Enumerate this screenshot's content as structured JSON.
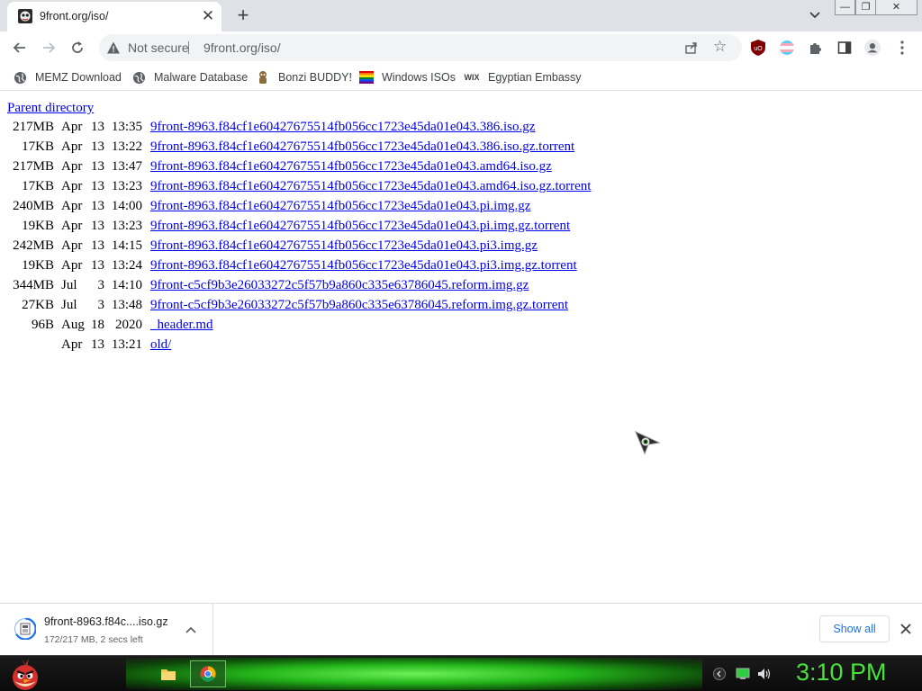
{
  "tab": {
    "title": "9front.org/iso/",
    "close_glyph": "✕",
    "newtab_glyph": "+"
  },
  "window_controls": {
    "minimize": "—",
    "restore": "❐",
    "close": "✕"
  },
  "omnibox": {
    "security_text": "Not secure",
    "url": "9front.org/iso/"
  },
  "bookmarks": [
    {
      "label": "MEMZ Download",
      "icon": "globe-icon"
    },
    {
      "label": "Malware Database",
      "icon": "globe-icon"
    },
    {
      "label": "Bonzi BUDDY!",
      "icon": "bonzi-icon"
    },
    {
      "label": "Windows ISOs",
      "icon": "rainbow-flag-icon"
    },
    {
      "label": "Egyptian Embassy",
      "icon": "wix-icon"
    }
  ],
  "page": {
    "parent_link": "Parent directory",
    "files": [
      {
        "size": "217MB",
        "month": "Apr",
        "day": "13",
        "time": "13:35",
        "name": "9front-8963.f84cf1e60427675514fb056cc1723e45da01e043.386.iso.gz"
      },
      {
        "size": "17KB",
        "month": "Apr",
        "day": "13",
        "time": "13:22",
        "name": "9front-8963.f84cf1e60427675514fb056cc1723e45da01e043.386.iso.gz.torrent"
      },
      {
        "size": "217MB",
        "month": "Apr",
        "day": "13",
        "time": "13:47",
        "name": "9front-8963.f84cf1e60427675514fb056cc1723e45da01e043.amd64.iso.gz"
      },
      {
        "size": "17KB",
        "month": "Apr",
        "day": "13",
        "time": "13:23",
        "name": "9front-8963.f84cf1e60427675514fb056cc1723e45da01e043.amd64.iso.gz.torrent"
      },
      {
        "size": "240MB",
        "month": "Apr",
        "day": "13",
        "time": "14:00",
        "name": "9front-8963.f84cf1e60427675514fb056cc1723e45da01e043.pi.img.gz"
      },
      {
        "size": "19KB",
        "month": "Apr",
        "day": "13",
        "time": "13:23",
        "name": "9front-8963.f84cf1e60427675514fb056cc1723e45da01e043.pi.img.gz.torrent"
      },
      {
        "size": "242MB",
        "month": "Apr",
        "day": "13",
        "time": "14:15",
        "name": "9front-8963.f84cf1e60427675514fb056cc1723e45da01e043.pi3.img.gz"
      },
      {
        "size": "19KB",
        "month": "Apr",
        "day": "13",
        "time": "13:24",
        "name": "9front-8963.f84cf1e60427675514fb056cc1723e45da01e043.pi3.img.gz.torrent"
      },
      {
        "size": "344MB",
        "month": "Jul",
        "day": "3",
        "time": "14:10",
        "name": "9front-c5cf9b3e26033272c5f57b9a860c335e63786045.reform.img.gz"
      },
      {
        "size": "27KB",
        "month": "Jul",
        "day": "3",
        "time": "13:48",
        "name": "9front-c5cf9b3e26033272c5f57b9a860c335e63786045.reform.img.gz.torrent"
      },
      {
        "size": "96B",
        "month": "Aug",
        "day": "18",
        "time": "2020",
        "name": "_header.md"
      },
      {
        "size": "",
        "month": "Apr",
        "day": "13",
        "time": "13:21",
        "name": "old/"
      }
    ]
  },
  "download": {
    "name": "9front-8963.f84c....iso.gz",
    "status": "172/217 MB, 2 secs left",
    "show_all": "Show all"
  },
  "taskbar": {
    "clock": "3:10 PM"
  },
  "colors": {
    "link": "#0000ee",
    "clock": "#49e23d",
    "accent": "#1a73e8"
  }
}
